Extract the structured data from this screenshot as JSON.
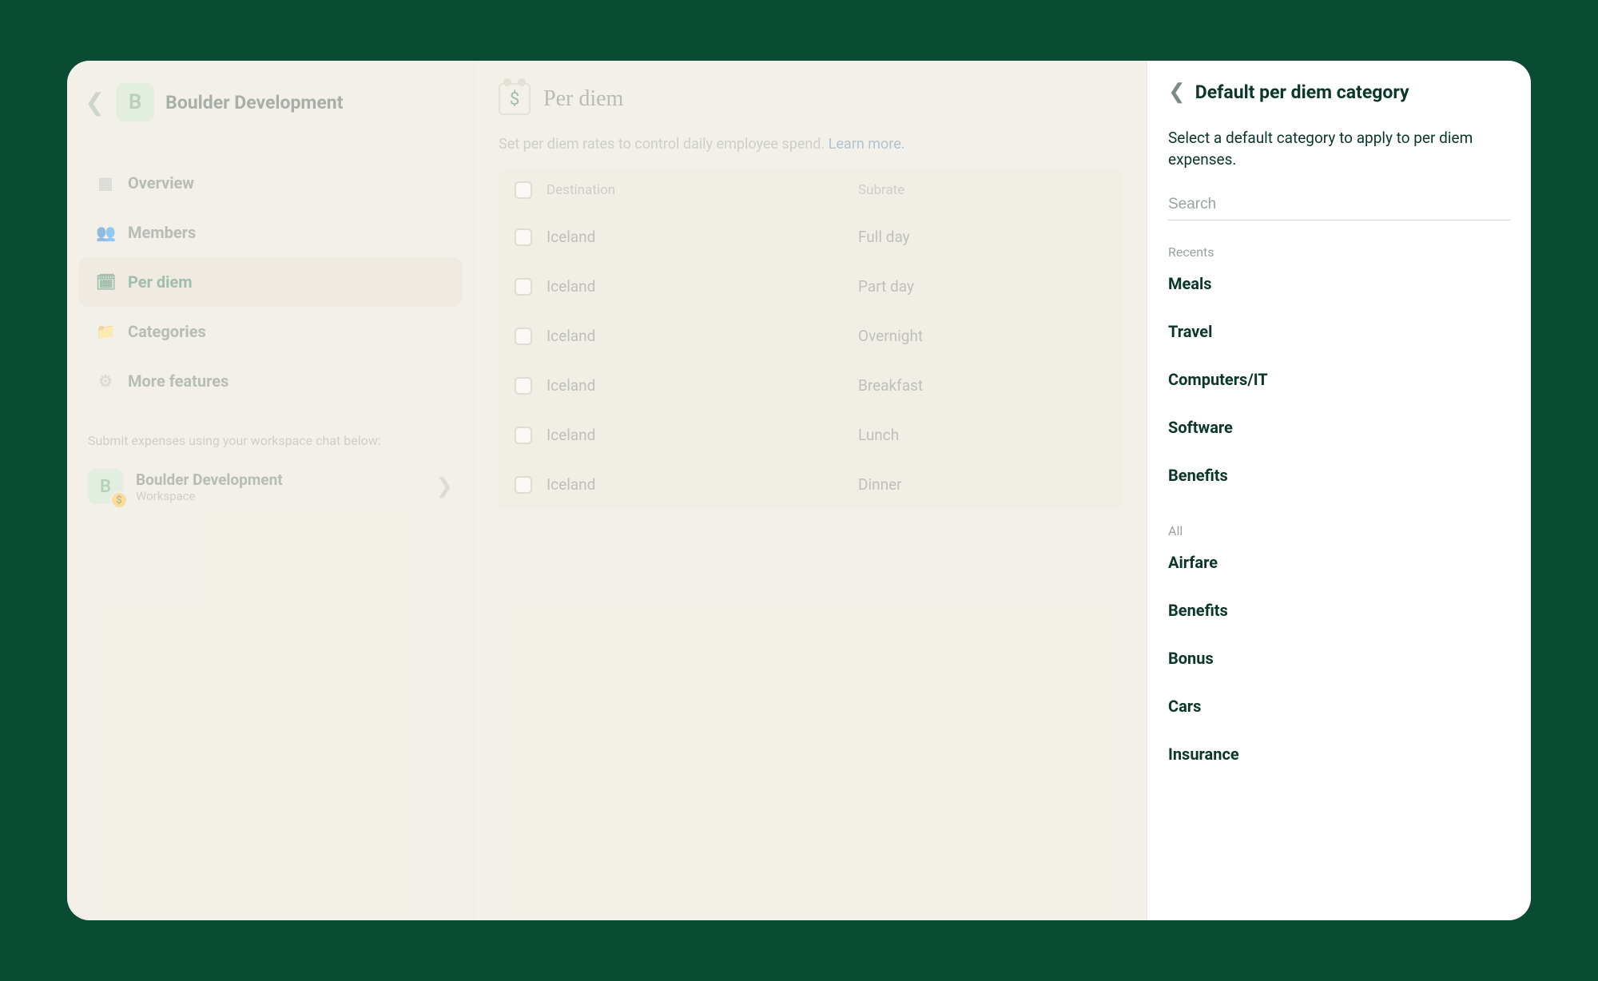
{
  "workspace": {
    "avatar_letter": "B",
    "name": "Boulder Development"
  },
  "sidebar": {
    "items": [
      {
        "label": "Overview"
      },
      {
        "label": "Members"
      },
      {
        "label": "Per diem"
      },
      {
        "label": "Categories"
      },
      {
        "label": "More features"
      }
    ],
    "hint": "Submit expenses using your workspace chat below:",
    "chat": {
      "avatar_letter": "B",
      "title": "Boulder Development",
      "subtitle": "Workspace"
    }
  },
  "main": {
    "title": "Per diem",
    "description": "Set per diem rates to control daily employee spend. ",
    "learn_more": "Learn more.",
    "table": {
      "headers": {
        "destination": "Destination",
        "subrate": "Subrate"
      },
      "rows": [
        {
          "destination": "Iceland",
          "subrate": "Full day"
        },
        {
          "destination": "Iceland",
          "subrate": "Part day"
        },
        {
          "destination": "Iceland",
          "subrate": "Overnight"
        },
        {
          "destination": "Iceland",
          "subrate": "Breakfast"
        },
        {
          "destination": "Iceland",
          "subrate": "Lunch"
        },
        {
          "destination": "Iceland",
          "subrate": "Dinner"
        }
      ]
    }
  },
  "right_panel": {
    "title": "Default per diem category",
    "description": "Select a default category to apply to per diem expenses.",
    "search_placeholder": "Search",
    "recents_label": "Recents",
    "recents": [
      {
        "label": "Meals"
      },
      {
        "label": "Travel"
      },
      {
        "label": "Computers/IT"
      },
      {
        "label": "Software"
      },
      {
        "label": "Benefits"
      }
    ],
    "all_label": "All",
    "all": [
      {
        "label": "Airfare"
      },
      {
        "label": "Benefits"
      },
      {
        "label": "Bonus"
      },
      {
        "label": "Cars"
      },
      {
        "label": "Insurance"
      }
    ]
  }
}
